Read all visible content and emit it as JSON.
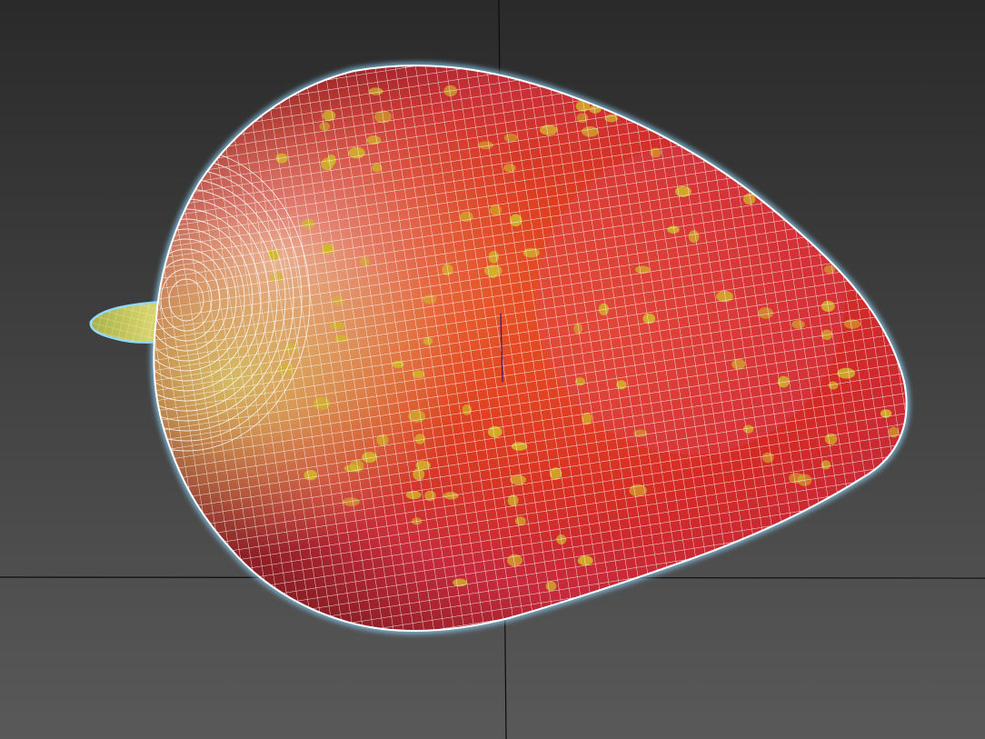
{
  "viewport": {
    "label": "",
    "colors": {
      "background_top": "#2a2a2a",
      "background_bottom": "#595959",
      "grid_line": "#0c0c0c",
      "wireframe": "#ffffff",
      "selection_glow": "#8fd8ff",
      "fruit_red": "#d72a24",
      "fruit_orange": "#e6581c",
      "fruit_pink": "#d94a70",
      "stem_yellow": "#c9c860",
      "seed_yellow": "#d2b82a"
    },
    "object": {
      "icon": "strawberry-mesh-icon",
      "selected": true,
      "display_mode": "textured-wireframe"
    }
  }
}
